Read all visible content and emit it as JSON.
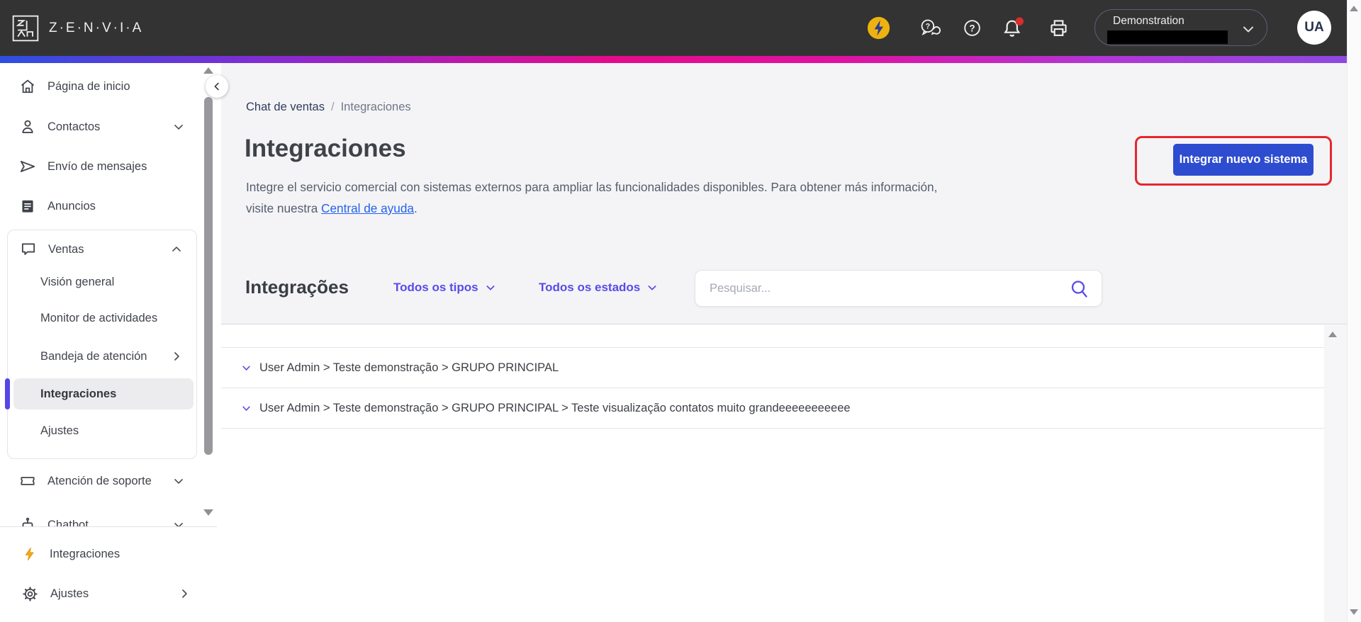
{
  "topbar": {
    "brand": "Z·E·N·V·I·A",
    "org_selector": {
      "label": "Demonstration"
    },
    "avatar_initials": "UA"
  },
  "sidebar": {
    "items": [
      {
        "label": "Página de inicio",
        "icon": "home"
      },
      {
        "label": "Contactos",
        "icon": "person",
        "chevron": "down"
      },
      {
        "label": "Envío de mensajes",
        "icon": "send"
      },
      {
        "label": "Anuncios",
        "icon": "news"
      },
      {
        "label": "Atención de soporte",
        "icon": "ticket",
        "chevron": "down"
      },
      {
        "label": "Chatbot",
        "icon": "bot",
        "chevron": "down",
        "clipped": true
      }
    ],
    "ventas_group": {
      "label": "Ventas",
      "icon": "chat-bubble",
      "chevron": "up",
      "children": [
        {
          "label": "Visión general"
        },
        {
          "label": "Monitor de actividades"
        },
        {
          "label": "Bandeja de atención",
          "chevron": "right"
        },
        {
          "label": "Integraciones",
          "selected": true
        },
        {
          "label": "Ajustes"
        }
      ]
    },
    "bottom_items": [
      {
        "label": "Integraciones",
        "icon": "bolt-yellow"
      },
      {
        "label": "Ajustes",
        "icon": "gear",
        "chevron": "right"
      }
    ]
  },
  "breadcrumb": {
    "parent": "Chat de ventas",
    "separator": "/",
    "current": "Integraciones"
  },
  "page": {
    "title": "Integraciones",
    "description_before": "Integre el servicio comercial con sistemas externos para ampliar las funcionalidades disponibles. Para obtener más información, visite nuestra ",
    "help_link": "Central de ayuda",
    "description_after": "."
  },
  "actions": {
    "new_integration": "Integrar nuevo sistema"
  },
  "panel": {
    "heading": "Integrações",
    "type_filter": "Todos os tipos",
    "status_filter": "Todos os estados",
    "search_placeholder": "Pesquisar..."
  },
  "list": {
    "rows": [
      {
        "label": "User Admin > Teste demonstração > GRUPO PRINCIPAL"
      },
      {
        "label": "User Admin > Teste demonstração > GRUPO PRINCIPAL > Teste visualização contatos muito grandeeeeeeeeeee"
      }
    ]
  },
  "colors": {
    "topbar": "#333333",
    "accent": "#5A4BE8",
    "primary_button": "#2E4CD0",
    "annotation_outline": "#E5272E",
    "notification_dot": "#D92C2C",
    "bolt_yellow": "#EDB211",
    "gradient": [
      "#2D4FE0",
      "#8C28CF",
      "#E30B8C",
      "#E011A0",
      "#B136D6",
      "#8D49E0"
    ]
  }
}
